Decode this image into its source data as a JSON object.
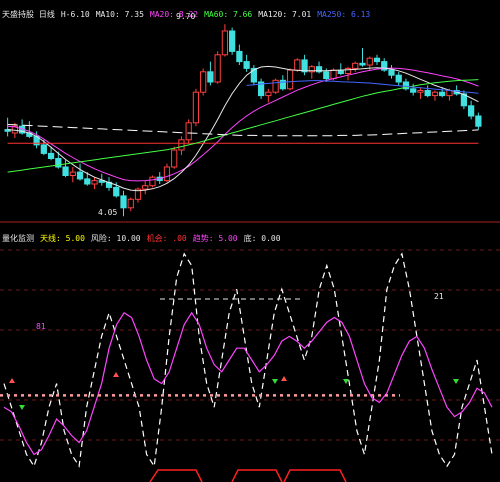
{
  "top_panel": {
    "legend": [
      {
        "text": "天盛持股 日线",
        "color": "#e8e8e8"
      },
      {
        "text": "H-6.10",
        "color": "#e8e8e8"
      },
      {
        "text": "MA10: 7.35",
        "color": "#e8e8e8"
      },
      {
        "text": "MA20: 8.22",
        "color": "#ff44ff"
      },
      {
        "text": "MA60: 7.66",
        "color": "#44ff44"
      },
      {
        "text": "MA120: 7.01",
        "color": "#e8e8e8"
      },
      {
        "text": "MA250: 6.13",
        "color": "#4466ff"
      }
    ],
    "high_label": "9.70",
    "low_label": "4.05"
  },
  "bottom_panel": {
    "legend": [
      {
        "text": "量化监测",
        "color": "#e8e8e8"
      },
      {
        "text": "天线: 5.00",
        "color": "#ffff00"
      },
      {
        "text": "风险: 10.00",
        "color": "#e8e8e8"
      },
      {
        "text": "机会: .00",
        "color": "#ff3333"
      },
      {
        "text": "趋势: 5.00",
        "color": "#ff44ff"
      },
      {
        "text": "底: 0.00",
        "color": "#e8e8e8"
      }
    ],
    "left_label": "81",
    "right_label": "21"
  },
  "chart_data": [
    {
      "type": "candlestick",
      "title": "天盛持股 日线",
      "ylim": [
        4,
        10
      ],
      "candles": [
        {
          "o": 6.6,
          "h": 6.95,
          "l": 6.4,
          "c": 6.55
        },
        {
          "o": 6.5,
          "h": 6.8,
          "l": 6.35,
          "c": 6.7
        },
        {
          "o": 6.7,
          "h": 6.9,
          "l": 6.45,
          "c": 6.5
        },
        {
          "o": 6.5,
          "h": 6.85,
          "l": 6.35,
          "c": 6.4
        },
        {
          "o": 6.4,
          "h": 6.55,
          "l": 6.05,
          "c": 6.15
        },
        {
          "o": 6.15,
          "h": 6.3,
          "l": 5.85,
          "c": 5.9
        },
        {
          "o": 5.9,
          "h": 6.1,
          "l": 5.7,
          "c": 5.75
        },
        {
          "o": 5.75,
          "h": 5.95,
          "l": 5.45,
          "c": 5.5
        },
        {
          "o": 5.5,
          "h": 5.7,
          "l": 5.2,
          "c": 5.25
        },
        {
          "o": 5.25,
          "h": 5.5,
          "l": 5.05,
          "c": 5.35
        },
        {
          "o": 5.35,
          "h": 5.6,
          "l": 5.1,
          "c": 5.15
        },
        {
          "o": 5.15,
          "h": 5.35,
          "l": 4.95,
          "c": 5.0
        },
        {
          "o": 5.0,
          "h": 5.2,
          "l": 4.85,
          "c": 5.1
        },
        {
          "o": 5.1,
          "h": 5.3,
          "l": 4.95,
          "c": 5.05
        },
        {
          "o": 5.05,
          "h": 5.2,
          "l": 4.8,
          "c": 4.9
        },
        {
          "o": 4.9,
          "h": 5.05,
          "l": 4.6,
          "c": 4.65
        },
        {
          "o": 4.65,
          "h": 4.8,
          "l": 4.05,
          "c": 4.3
        },
        {
          "o": 4.3,
          "h": 4.6,
          "l": 4.2,
          "c": 4.55
        },
        {
          "o": 4.55,
          "h": 4.9,
          "l": 4.45,
          "c": 4.85
        },
        {
          "o": 4.85,
          "h": 5.1,
          "l": 4.7,
          "c": 4.95
        },
        {
          "o": 4.95,
          "h": 5.25,
          "l": 4.9,
          "c": 5.2
        },
        {
          "o": 5.2,
          "h": 5.35,
          "l": 5.0,
          "c": 5.1
        },
        {
          "o": 5.1,
          "h": 5.6,
          "l": 5.05,
          "c": 5.5
        },
        {
          "o": 5.5,
          "h": 6.1,
          "l": 5.45,
          "c": 6.0
        },
        {
          "o": 6.0,
          "h": 6.4,
          "l": 5.85,
          "c": 6.3
        },
        {
          "o": 6.3,
          "h": 6.9,
          "l": 6.2,
          "c": 6.8
        },
        {
          "o": 6.8,
          "h": 7.8,
          "l": 6.7,
          "c": 7.7
        },
        {
          "o": 7.7,
          "h": 8.4,
          "l": 7.6,
          "c": 8.3
        },
        {
          "o": 8.3,
          "h": 8.6,
          "l": 7.9,
          "c": 8.0
        },
        {
          "o": 8.0,
          "h": 8.9,
          "l": 7.95,
          "c": 8.8
        },
        {
          "o": 8.8,
          "h": 9.7,
          "l": 8.75,
          "c": 9.5
        },
        {
          "o": 9.5,
          "h": 9.6,
          "l": 8.8,
          "c": 8.9
        },
        {
          "o": 8.9,
          "h": 9.1,
          "l": 8.5,
          "c": 8.6
        },
        {
          "o": 8.6,
          "h": 8.8,
          "l": 8.3,
          "c": 8.4
        },
        {
          "o": 8.4,
          "h": 8.5,
          "l": 7.9,
          "c": 8.0
        },
        {
          "o": 8.0,
          "h": 8.1,
          "l": 7.5,
          "c": 7.6
        },
        {
          "o": 7.6,
          "h": 7.8,
          "l": 7.4,
          "c": 7.7
        },
        {
          "o": 7.7,
          "h": 8.1,
          "l": 7.65,
          "c": 8.05
        },
        {
          "o": 8.05,
          "h": 8.2,
          "l": 7.75,
          "c": 7.8
        },
        {
          "o": 7.8,
          "h": 8.4,
          "l": 7.75,
          "c": 8.35
        },
        {
          "o": 8.35,
          "h": 8.7,
          "l": 8.3,
          "c": 8.65
        },
        {
          "o": 8.65,
          "h": 8.8,
          "l": 8.2,
          "c": 8.3
        },
        {
          "o": 8.3,
          "h": 8.5,
          "l": 8.1,
          "c": 8.45
        },
        {
          "o": 8.45,
          "h": 8.6,
          "l": 8.25,
          "c": 8.3
        },
        {
          "o": 8.3,
          "h": 8.4,
          "l": 8.0,
          "c": 8.1
        },
        {
          "o": 8.1,
          "h": 8.4,
          "l": 8.05,
          "c": 8.35
        },
        {
          "o": 8.35,
          "h": 8.55,
          "l": 8.2,
          "c": 8.25
        },
        {
          "o": 8.25,
          "h": 8.45,
          "l": 8.05,
          "c": 8.4
        },
        {
          "o": 8.4,
          "h": 8.6,
          "l": 8.3,
          "c": 8.55
        },
        {
          "o": 8.55,
          "h": 9.0,
          "l": 8.45,
          "c": 8.5
        },
        {
          "o": 8.5,
          "h": 8.75,
          "l": 8.35,
          "c": 8.7
        },
        {
          "o": 8.7,
          "h": 8.8,
          "l": 8.5,
          "c": 8.6
        },
        {
          "o": 8.6,
          "h": 8.7,
          "l": 8.3,
          "c": 8.35
        },
        {
          "o": 8.35,
          "h": 8.5,
          "l": 8.1,
          "c": 8.2
        },
        {
          "o": 8.2,
          "h": 8.3,
          "l": 7.9,
          "c": 8.0
        },
        {
          "o": 8.0,
          "h": 8.1,
          "l": 7.75,
          "c": 7.8
        },
        {
          "o": 7.8,
          "h": 7.95,
          "l": 7.6,
          "c": 7.7
        },
        {
          "o": 7.7,
          "h": 7.85,
          "l": 7.5,
          "c": 7.75
        },
        {
          "o": 7.75,
          "h": 7.9,
          "l": 7.55,
          "c": 7.6
        },
        {
          "o": 7.6,
          "h": 7.75,
          "l": 7.45,
          "c": 7.7
        },
        {
          "o": 7.7,
          "h": 7.85,
          "l": 7.55,
          "c": 7.6
        },
        {
          "o": 7.6,
          "h": 7.8,
          "l": 7.45,
          "c": 7.75
        },
        {
          "o": 7.75,
          "h": 7.9,
          "l": 7.6,
          "c": 7.65
        },
        {
          "o": 7.65,
          "h": 7.75,
          "l": 7.2,
          "c": 7.3
        },
        {
          "o": 7.3,
          "h": 7.45,
          "l": 6.9,
          "c": 7.0
        },
        {
          "o": 7.0,
          "h": 7.1,
          "l": 6.6,
          "c": 6.7
        }
      ],
      "ma": [
        {
          "name": "MA20",
          "color": "#ff44ff",
          "values": [
            6.7,
            6.68,
            6.62,
            6.55,
            6.45,
            6.32,
            6.18,
            6.04,
            5.9,
            5.78,
            5.66,
            5.55,
            5.45,
            5.36,
            5.28,
            5.2,
            5.13,
            5.1,
            5.09,
            5.1,
            5.12,
            5.16,
            5.22,
            5.3,
            5.4,
            5.52,
            5.68,
            5.86,
            6.04,
            6.24,
            6.46,
            6.66,
            6.84,
            7.0,
            7.14,
            7.26,
            7.36,
            7.46,
            7.56,
            7.66,
            7.76,
            7.84,
            7.92,
            7.99,
            8.05,
            8.1,
            8.15,
            8.2,
            8.25,
            8.3,
            8.34,
            8.38,
            8.4,
            8.41,
            8.4,
            8.38,
            8.35,
            8.31,
            8.27,
            8.23,
            8.18,
            8.14,
            8.09,
            8.03,
            7.96,
            7.88
          ]
        },
        {
          "name": "MA10",
          "color": "#e8e8e8",
          "values": [
            6.6,
            6.58,
            6.55,
            6.5,
            6.4,
            6.25,
            6.08,
            5.9,
            5.72,
            5.57,
            5.43,
            5.31,
            5.2,
            5.12,
            5.04,
            4.97,
            4.88,
            4.82,
            4.8,
            4.82,
            4.86,
            4.92,
            5.02,
            5.16,
            5.34,
            5.56,
            5.84,
            6.18,
            6.52,
            6.9,
            7.3,
            7.66,
            7.96,
            8.2,
            8.36,
            8.44,
            8.46,
            8.44,
            8.4,
            8.36,
            8.34,
            8.33,
            8.33,
            8.33,
            8.33,
            8.34,
            8.35,
            8.36,
            8.37,
            8.39,
            8.41,
            8.42,
            8.41,
            8.38,
            8.33,
            8.26,
            8.17,
            8.08,
            7.99,
            7.9,
            7.83,
            7.76,
            7.71,
            7.63,
            7.53,
            7.42
          ]
        },
        {
          "name": "MA120",
          "color": "#ff3333",
          "values": [
            6.2,
            6.2,
            6.2,
            6.2,
            6.2,
            6.2,
            6.2,
            6.2,
            6.2,
            6.2,
            6.2,
            6.2,
            6.2,
            6.2,
            6.2,
            6.2,
            6.2,
            6.2,
            6.2,
            6.2,
            6.2,
            6.2,
            6.2,
            6.2,
            6.2,
            6.2,
            6.2,
            6.2,
            6.2,
            6.2,
            6.2,
            6.2,
            6.2,
            6.2,
            6.2,
            6.2,
            6.2,
            6.2,
            6.2,
            6.2,
            6.2,
            6.2,
            6.2,
            6.2,
            6.2,
            6.2,
            6.2,
            6.2,
            6.2,
            6.2,
            6.2,
            6.2,
            6.2,
            6.2,
            6.2,
            6.2,
            6.2,
            6.2,
            6.2,
            6.2,
            6.2,
            6.2,
            6.2,
            6.2,
            6.2,
            6.2
          ]
        },
        {
          "name": "MA60",
          "color": "#44ff44",
          "values": [
            5.35,
            5.38,
            5.41,
            5.44,
            5.47,
            5.5,
            5.53,
            5.56,
            5.59,
            5.62,
            5.65,
            5.68,
            5.71,
            5.74,
            5.77,
            5.8,
            5.83,
            5.86,
            5.89,
            5.92,
            5.95,
            5.98,
            6.01,
            6.05,
            6.1,
            6.15,
            6.2,
            6.26,
            6.32,
            6.38,
            6.44,
            6.5,
            6.56,
            6.62,
            6.68,
            6.74,
            6.8,
            6.86,
            6.92,
            6.98,
            7.04,
            7.1,
            7.16,
            7.22,
            7.28,
            7.34,
            7.4,
            7.46,
            7.52,
            7.58,
            7.63,
            7.68,
            7.72,
            7.76,
            7.8,
            7.84,
            7.88,
            7.92,
            7.95,
            7.98,
            8.0,
            8.02,
            8.04,
            8.05,
            8.06,
            8.07
          ]
        },
        {
          "name": "MA250",
          "color": "#4466ff",
          "values": [
            null,
            null,
            null,
            null,
            null,
            null,
            null,
            null,
            null,
            null,
            null,
            null,
            null,
            null,
            null,
            null,
            null,
            null,
            null,
            null,
            null,
            null,
            null,
            null,
            null,
            null,
            null,
            null,
            null,
            null,
            null,
            null,
            null,
            7.9,
            7.92,
            7.94,
            7.96,
            7.98,
            8.0,
            8.01,
            8.02,
            8.03,
            8.04,
            8.04,
            8.03,
            8.02,
            8.01,
            8.0,
            7.99,
            7.98,
            7.97,
            7.95,
            7.93,
            7.91,
            7.89,
            7.87,
            7.85,
            7.83,
            7.81,
            7.79,
            7.77,
            7.75,
            7.73,
            7.71,
            7.69,
            7.67
          ]
        },
        {
          "name": "MA_long",
          "color": "#ffffff",
          "values": [
            6.75,
            6.74,
            6.73,
            6.72,
            6.71,
            6.7,
            6.69,
            6.68,
            6.67,
            6.66,
            6.65,
            6.64,
            6.63,
            6.62,
            6.61,
            6.6,
            6.59,
            6.58,
            6.57,
            6.56,
            6.55,
            6.54,
            6.53,
            6.52,
            6.51,
            6.5,
            6.49,
            6.48,
            6.47,
            6.46,
            6.45,
            6.44,
            6.43,
            6.43,
            6.43,
            6.42,
            6.42,
            6.42,
            6.42,
            6.42,
            6.42,
            6.42,
            6.42,
            6.42,
            6.42,
            6.42,
            6.43,
            6.43,
            6.43,
            6.44,
            6.44,
            6.45,
            6.46,
            6.47,
            6.48,
            6.49,
            6.5,
            6.51,
            6.52,
            6.53,
            6.54,
            6.55,
            6.56,
            6.57,
            6.58,
            6.59
          ]
        }
      ]
    },
    {
      "type": "line",
      "title": "量化监测",
      "ylim": [
        0,
        100
      ],
      "series": [
        {
          "name": "天线",
          "color": "#ffffff",
          "style": "dashed",
          "values": [
            40,
            30,
            20,
            10,
            5,
            15,
            30,
            40,
            20,
            10,
            5,
            30,
            45,
            60,
            70,
            60,
            50,
            40,
            30,
            10,
            5,
            30,
            60,
            85,
            95,
            90,
            60,
            40,
            30,
            50,
            70,
            80,
            60,
            40,
            30,
            50,
            70,
            80,
            70,
            60,
            50,
            60,
            80,
            90,
            80,
            60,
            40,
            20,
            10,
            30,
            50,
            80,
            90,
            95,
            80,
            60,
            40,
            20,
            10,
            5,
            10,
            30,
            40,
            50,
            30,
            10
          ]
        },
        {
          "name": "趋势",
          "color": "#ff44ff",
          "style": "solid",
          "values": [
            30,
            28,
            22,
            15,
            10,
            12,
            18,
            25,
            22,
            18,
            15,
            20,
            30,
            40,
            55,
            65,
            70,
            68,
            60,
            50,
            42,
            40,
            45,
            55,
            65,
            70,
            65,
            55,
            48,
            45,
            50,
            55,
            55,
            50,
            45,
            48,
            52,
            58,
            60,
            58,
            55,
            58,
            62,
            66,
            68,
            66,
            60,
            50,
            40,
            34,
            32,
            36,
            44,
            52,
            58,
            60,
            55,
            46,
            38,
            30,
            26,
            28,
            32,
            38,
            36,
            30
          ]
        }
      ],
      "level_dashed": 35
    }
  ]
}
